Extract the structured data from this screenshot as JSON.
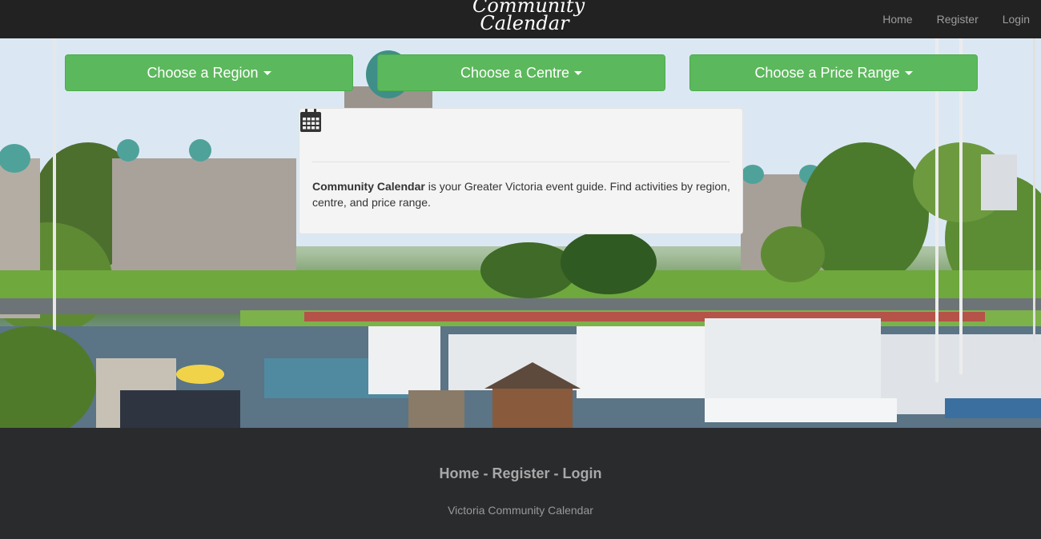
{
  "navbar": {
    "brand_line1": "Community",
    "brand_line2": "Calendar",
    "links": [
      "Home",
      "Register",
      "Login"
    ]
  },
  "filters": {
    "region_label": "Choose a Region",
    "centre_label": "Choose a Centre",
    "price_label": "Choose a Price Range"
  },
  "intro": {
    "brand_bold": "Community Calendar",
    "text": " is your Greater Victoria event guide. Find activities by region, centre, and price range."
  },
  "footer": {
    "home": "Home",
    "register": "Register",
    "login": "Login",
    "separator": " - ",
    "tagline": "Victoria Community Calendar"
  },
  "colors": {
    "navbar": "#222222",
    "button_green": "#5cb85c",
    "footer_bg": "#2a2b2d"
  }
}
